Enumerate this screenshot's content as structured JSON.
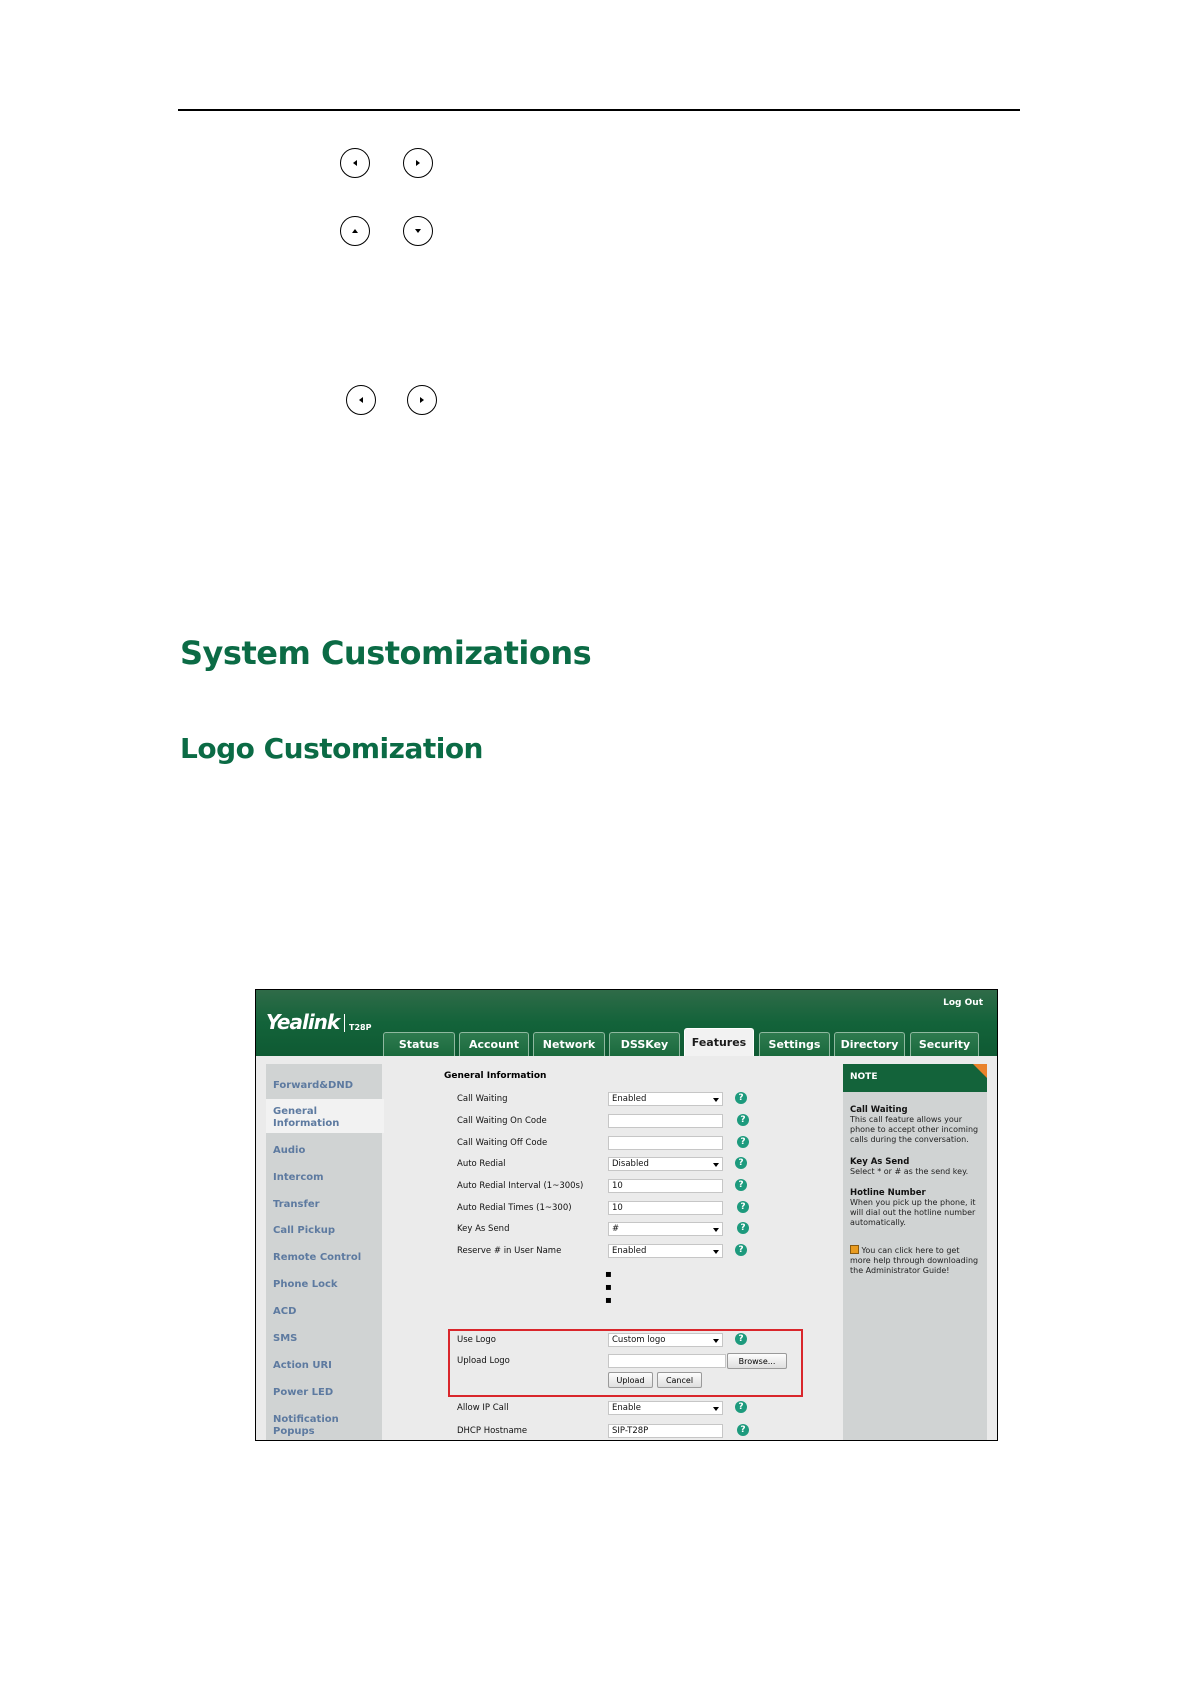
{
  "document": {
    "heading_main": "System Customizations",
    "heading_sub": "Logo Customization"
  },
  "nav_keys": [
    "left-arrow-icon",
    "right-arrow-icon",
    "up-arrow-icon",
    "down-arrow-icon"
  ],
  "screenshot": {
    "brand": "Yealink",
    "model": "T28P",
    "logout": "Log Out",
    "tabs": [
      "Status",
      "Account",
      "Network",
      "DSSKey",
      "Features",
      "Settings",
      "Directory",
      "Security"
    ],
    "active_tab": "Features",
    "sidebar": [
      "Forward&DND",
      "General Information",
      "Audio",
      "Intercom",
      "Transfer",
      "Call Pickup",
      "Remote Control",
      "Phone Lock",
      "ACD",
      "SMS",
      "Action URI",
      "Power LED",
      "Notification Popups"
    ],
    "section_title": "General Information",
    "rows": [
      {
        "label": "Call Waiting",
        "value": "Enabled"
      },
      {
        "label": "Call Waiting On Code",
        "value": ""
      },
      {
        "label": "Call Waiting Off Code",
        "value": ""
      },
      {
        "label": "Auto Redial",
        "value": "Disabled"
      },
      {
        "label": "Auto Redial Interval (1~300s)",
        "value": "10"
      },
      {
        "label": "Auto Redial Times (1~300)",
        "value": "10"
      },
      {
        "label": "Key As Send",
        "value": "#"
      },
      {
        "label": "Reserve # in User Name",
        "value": "Enabled"
      }
    ],
    "use_logo": {
      "label": "Use Logo",
      "value": "Custom logo"
    },
    "upload_logo": {
      "label": "Upload Logo",
      "browse": "Browse...",
      "upload": "Upload",
      "cancel": "Cancel"
    },
    "allow_ip_call": {
      "label": "Allow IP Call",
      "value": "Enable"
    },
    "dhcp_hostname": {
      "label": "DHCP Hostname",
      "value": "SIP-T28P"
    },
    "help_glyph": "?",
    "note": {
      "header": "NOTE",
      "items": [
        {
          "title": "Call Waiting",
          "text": "This call feature allows your phone to accept other incoming calls during the conversation."
        },
        {
          "title": "Key As Send",
          "text": "Select * or # as the send key."
        },
        {
          "title": "Hotline Number",
          "text": "When you pick up the phone, it will dial out the hotline number automatically."
        }
      ],
      "help_link": "You can click here to get more help through downloading the Administrator Guide!"
    }
  }
}
